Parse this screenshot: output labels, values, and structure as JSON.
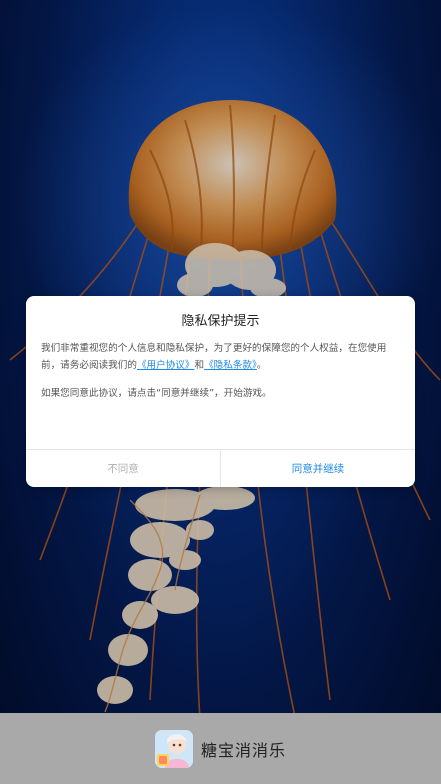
{
  "dialog": {
    "title": "隐私保护提示",
    "paragraph1_prefix": "我们非常重视您的个人信息和隐私保护，为了更好的保障您的个人权益，在您使用前，请务必阅读我们的",
    "user_agreement_link": "《用户协议》",
    "and_text": "和",
    "privacy_policy_link": "《隐私条款》",
    "paragraph1_suffix": "。",
    "paragraph2": "如果您同意此协议，请点击“同意并继续”，开始游戏。",
    "disagree_label": "不同意",
    "agree_label": "同意并继续"
  },
  "app_banner": {
    "name": "糖宝消消乐",
    "icon": "app-icon"
  },
  "colors": {
    "link": "#1e88e5",
    "disagree": "#b0b0b0",
    "banner_bg": "#a9a9a9",
    "background_top": "#0b3f9a",
    "background_bottom": "#020b2a"
  }
}
